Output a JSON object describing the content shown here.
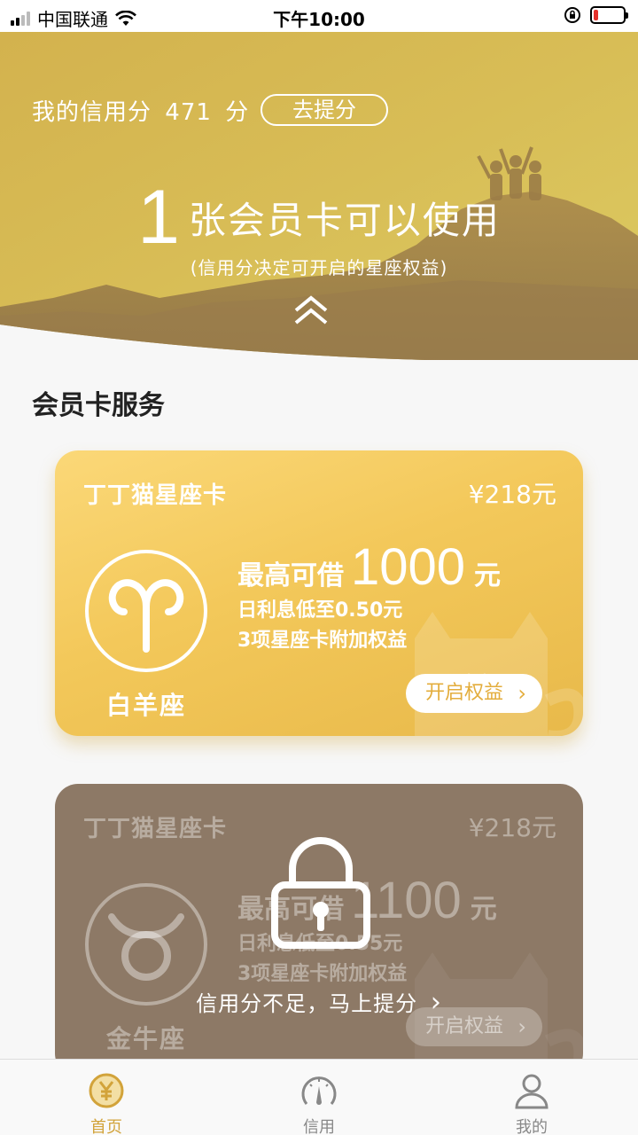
{
  "status_bar": {
    "carrier": "中国联通",
    "time": "下午10:00",
    "battery_level": 0.15
  },
  "hero": {
    "credit_label": "我的信用分",
    "credit_score": "471",
    "credit_unit": "分",
    "boost_button": "去提分",
    "card_count": "1",
    "card_count_text": "张会员卡可以使用",
    "subtitle": "(信用分决定可开启的星座权益)"
  },
  "section": {
    "title": "会员卡服务"
  },
  "cards": [
    {
      "title": "丁丁猫星座卡",
      "price": "¥218元",
      "sign": "白羊座",
      "limit_label": "最高可借",
      "limit_amount": "1000",
      "limit_unit": "元",
      "rate": "日利息低至0.50元",
      "perks": "3项星座卡附加权益",
      "button": "开启权益",
      "locked": false
    },
    {
      "title": "丁丁猫星座卡",
      "price": "¥218元",
      "sign": "金牛座",
      "limit_label": "最高可借",
      "limit_amount": "1100",
      "limit_unit": "元",
      "rate": "日利息低至0.55元",
      "perks": "3项星座卡附加权益",
      "button": "开启权益",
      "locked": true,
      "locked_message": "信用分不足，马上提分"
    }
  ],
  "tabs": [
    {
      "label": "首页",
      "icon": "yen-circle-icon",
      "active": true
    },
    {
      "label": "信用",
      "icon": "gauge-icon",
      "active": false
    },
    {
      "label": "我的",
      "icon": "person-icon",
      "active": false
    }
  ],
  "colors": {
    "accent": "#d2a33a",
    "gold_card": "#f3c85a",
    "locked_card": "#8d7966"
  }
}
